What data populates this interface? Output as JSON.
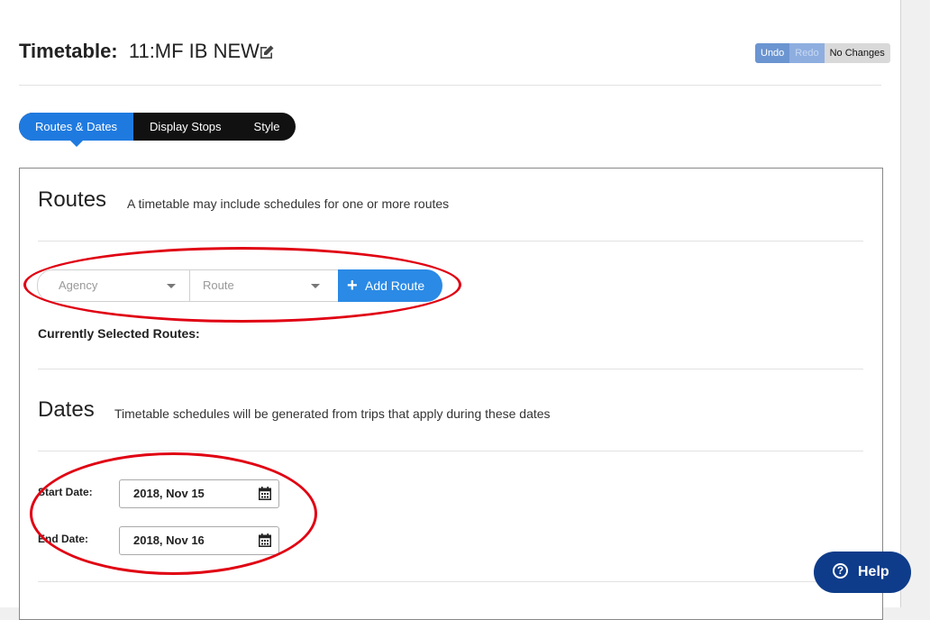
{
  "header": {
    "title_label": "Timetable:",
    "title_value": "11:MF IB NEW",
    "edit_icon": "edit-icon",
    "undo_label": "Undo",
    "redo_label": "Redo",
    "status_label": "No Changes"
  },
  "tabs": [
    {
      "label": "Routes & Dates",
      "active": true
    },
    {
      "label": "Display Stops",
      "active": false
    },
    {
      "label": "Style",
      "active": false
    }
  ],
  "routes": {
    "title": "Routes",
    "description": "A timetable may include schedules for one or more routes",
    "agency_placeholder": "Agency",
    "route_placeholder": "Route",
    "add_button_label": "Add Route",
    "selected_label": "Currently Selected Routes:"
  },
  "dates": {
    "title": "Dates",
    "description": "Timetable schedules will be generated from trips that apply during these dates",
    "start_label": "Start Date:",
    "start_value": "2018, Nov 15",
    "end_label": "End Date:",
    "end_value": "2018, Nov 16",
    "calendar_icon": "calendar-icon"
  },
  "help": {
    "label": "Help",
    "icon": "question-circle-icon"
  },
  "colors": {
    "accent": "#1f7ae0",
    "add_route": "#2a8ae6",
    "help": "#0e3c8a",
    "annotation": "#e00012"
  }
}
